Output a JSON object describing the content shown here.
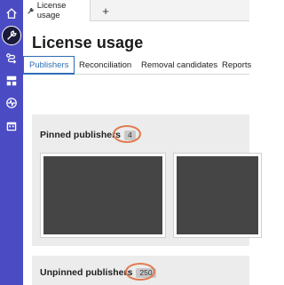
{
  "rail": {
    "items": [
      {
        "icon": "home-icon"
      },
      {
        "icon": "wrench-icon",
        "active": true
      },
      {
        "icon": "route-icon"
      },
      {
        "icon": "layout-icon"
      },
      {
        "icon": "activity-icon"
      },
      {
        "icon": "calendar-icon"
      }
    ]
  },
  "tabstrip": {
    "active_tab": {
      "label": "License usage",
      "icon": "wrench-icon"
    },
    "new_tab_label": "+"
  },
  "page": {
    "title": "License usage"
  },
  "subtabs": [
    {
      "label": "Publishers",
      "active": true
    },
    {
      "label": "Reconciliation"
    },
    {
      "label": "Removal candidates"
    },
    {
      "label": "Reports"
    }
  ],
  "sections": {
    "pinned": {
      "title": "Pinned publishers",
      "count": "4"
    },
    "unpinned": {
      "title": "Unpinned publishers",
      "count": "250"
    }
  },
  "colors": {
    "rail": "#4b4bc4",
    "accent": "#2f6db5",
    "highlight": "#e07b4f",
    "thumbnail": "#454545"
  }
}
